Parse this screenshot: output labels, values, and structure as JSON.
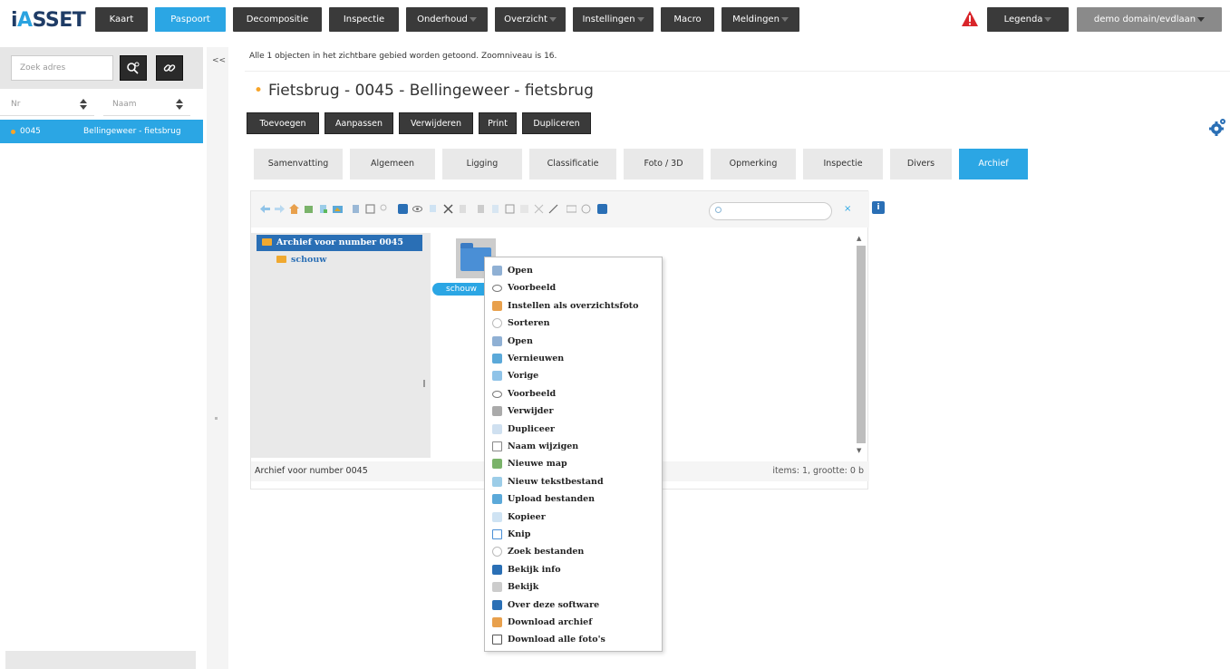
{
  "app": {
    "logo_text_prefix": "i",
    "logo_text_accent": "A",
    "logo_text_suffix": "SSET",
    "brand_color": "#2ba6e4"
  },
  "nav": {
    "items": [
      {
        "label": "Kaart",
        "active": false,
        "dropdown": false
      },
      {
        "label": "Paspoort",
        "active": true,
        "dropdown": false
      },
      {
        "label": "Decompositie",
        "active": false,
        "dropdown": false
      },
      {
        "label": "Inspectie",
        "active": false,
        "dropdown": false
      },
      {
        "label": "Onderhoud",
        "active": false,
        "dropdown": true
      },
      {
        "label": "Overzicht",
        "active": false,
        "dropdown": true
      },
      {
        "label": "Instellingen",
        "active": false,
        "dropdown": true
      },
      {
        "label": "Macro",
        "active": false,
        "dropdown": false
      },
      {
        "label": "Meldingen",
        "active": false,
        "dropdown": true
      }
    ],
    "legend_label": "Legenda",
    "user_label": "demo domain/evdlaan"
  },
  "sidebar": {
    "search_placeholder": "Zoek adres",
    "col_nr": "Nr",
    "col_naam": "Naam",
    "rows": [
      {
        "nr": "0045",
        "naam": "Bellingeweer - fietsbrug"
      }
    ],
    "collapse_label": "<<"
  },
  "main": {
    "info_text": "Alle 1 objecten in het zichtbare gebied worden getoond. Zoomniveau is 16.",
    "title": "Fietsbrug - 0045 - Bellingeweer - fietsbrug",
    "actions": [
      "Toevoegen",
      "Aanpassen",
      "Verwijderen",
      "Print",
      "Dupliceren"
    ],
    "tabs": [
      {
        "label": "Samenvatting",
        "active": false
      },
      {
        "label": "Algemeen",
        "active": false
      },
      {
        "label": "Ligging",
        "active": false
      },
      {
        "label": "Classificatie",
        "active": false
      },
      {
        "label": "Foto / 3D",
        "active": false
      },
      {
        "label": "Opmerking",
        "active": false
      },
      {
        "label": "Inspectie",
        "active": false
      },
      {
        "label": "Divers",
        "active": false
      },
      {
        "label": "Archief",
        "active": true
      }
    ]
  },
  "filemanager": {
    "tree_root": "Archief voor number 0045",
    "tree_child": "schouw",
    "file_label": "schouw",
    "status_left": "Archief voor number 0045",
    "status_right": "items: 1, grootte: 0 b",
    "clear_search": "×",
    "info_badge": "i"
  },
  "context_menu": {
    "items": [
      {
        "label": "Open",
        "icon": "file-icon"
      },
      {
        "label": "Voorbeeld",
        "icon": "eye-icon"
      },
      {
        "label": "Instellen als overzichtsfoto",
        "icon": "home-icon"
      },
      {
        "label": "Sorteren",
        "icon": "sort-icon"
      },
      {
        "label": "Open",
        "icon": "file-icon"
      },
      {
        "label": "Vernieuwen",
        "icon": "refresh-icon"
      },
      {
        "label": "Vorige",
        "icon": "back-arrow-icon"
      },
      {
        "label": "Voorbeeld",
        "icon": "eye-icon"
      },
      {
        "label": "Verwijder",
        "icon": "trash-icon"
      },
      {
        "label": "Dupliceer",
        "icon": "duplicate-icon"
      },
      {
        "label": "Naam wijzigen",
        "icon": "rename-icon"
      },
      {
        "label": "Nieuwe map",
        "icon": "new-folder-icon"
      },
      {
        "label": "Nieuw tekstbestand",
        "icon": "new-file-icon"
      },
      {
        "label": "Upload bestanden",
        "icon": "upload-icon"
      },
      {
        "label": "Kopieer",
        "icon": "copy-icon"
      },
      {
        "label": "Knip",
        "icon": "cut-icon"
      },
      {
        "label": "Zoek bestanden",
        "icon": "search-icon"
      },
      {
        "label": "Bekijk info",
        "icon": "info-icon"
      },
      {
        "label": "Bekijk",
        "icon": "view-icon"
      },
      {
        "label": "Over deze software",
        "icon": "help-icon"
      },
      {
        "label": "Download archief",
        "icon": "download-archive-icon"
      },
      {
        "label": "Download alle foto's",
        "icon": "save-icon"
      }
    ]
  }
}
